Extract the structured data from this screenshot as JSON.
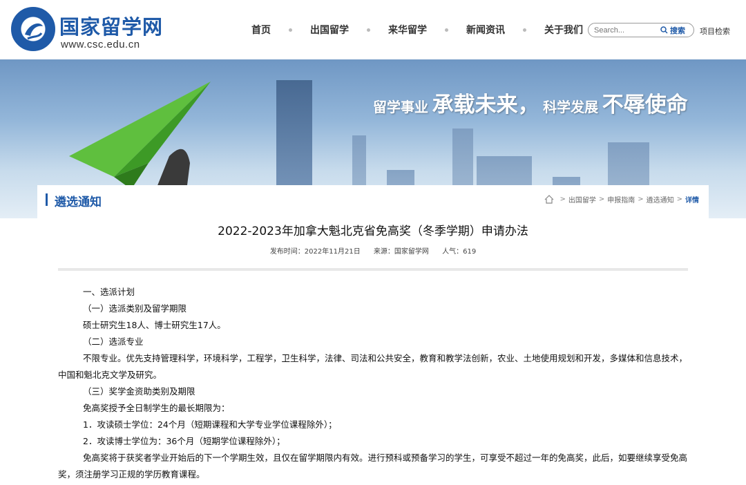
{
  "header": {
    "logo_title": "国家留学网",
    "logo_url": "www.csc.edu.cn",
    "nav": [
      "首页",
      "出国留学",
      "来华留学",
      "新闻资讯",
      "关于我们"
    ],
    "search_placeholder": "Search...",
    "search_button": "搜索",
    "project_search": "项目检索"
  },
  "banner": {
    "slogan_part1": "留学事业",
    "slogan_part2": "承载未来，",
    "slogan_part3": "科学发展",
    "slogan_part4": "不辱使命"
  },
  "section": {
    "title": "遴选通知",
    "breadcrumb": [
      "出国留学",
      "申报指南",
      "遴选通知",
      "详情"
    ]
  },
  "article": {
    "title": "2022-2023年加拿大魁北克省免高奖（冬季学期）申请办法",
    "meta_date": "发布时间：2022年11月21日",
    "meta_source": "来源：国家留学网",
    "meta_views": "人气：619",
    "paragraphs": [
      "一、选派计划",
      "（一）选派类别及留学期限",
      "硕士研究生18人、博士研究生17人。",
      "（二）选派专业",
      "不限专业。优先支持管理科学，环境科学，工程学，卫生科学，法律、司法和公共安全，教育和教学法创新，农业、土地使用规划和开发，多媒体和信息技术，中国和魁北克文学及研究。",
      "（三）奖学金资助类别及期限",
      "免高奖授予全日制学生的最长期限为：",
      "1．攻读硕士学位：24个月（短期课程和大学专业学位课程除外）；",
      "2．攻读博士学位为：36个月（短期学位课程除外）；",
      "免高奖将于获奖者学业开始后的下一个学期生效，且仅在留学期限内有效。进行预科或预备学习的学生，可享受不超过一年的免高奖，此后，如要继续享受免高奖，须注册学习正规的学历教育课程。"
    ]
  }
}
